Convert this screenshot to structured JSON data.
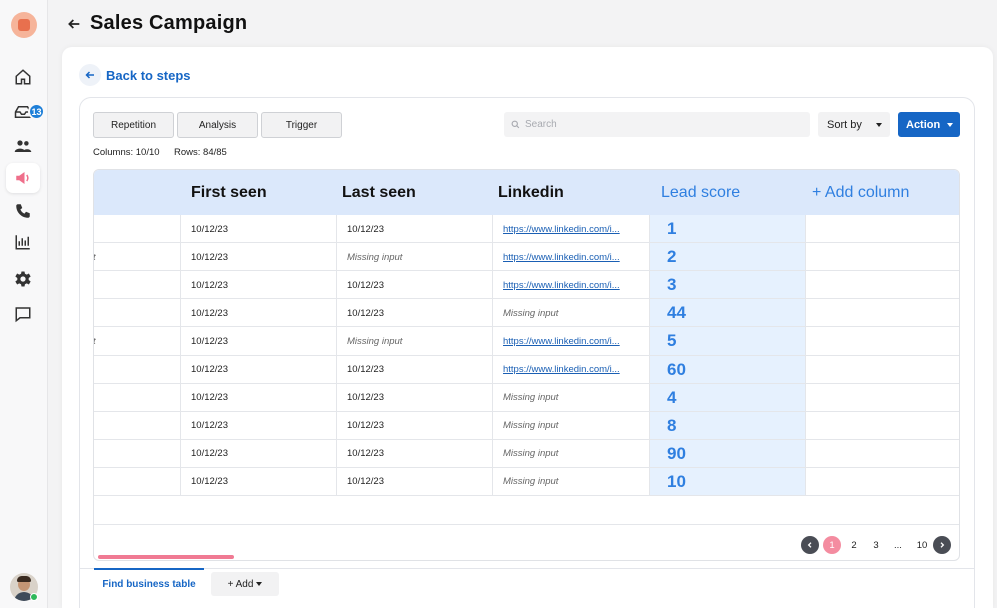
{
  "header": {
    "title": "Sales Campaign"
  },
  "nav": {
    "back_to_steps": "Back to steps",
    "notification_badge": "13"
  },
  "sidebar": {
    "items": [
      {
        "icon": "home-icon"
      },
      {
        "icon": "inbox-icon"
      },
      {
        "icon": "users-icon"
      },
      {
        "icon": "megaphone-icon",
        "active": true
      },
      {
        "icon": "phone-icon"
      },
      {
        "icon": "bar-chart-icon"
      },
      {
        "icon": "gear-icon"
      },
      {
        "icon": "chat-icon"
      }
    ]
  },
  "toolbar": {
    "tabs": [
      "Repetition",
      "Analysis",
      "Trigger"
    ],
    "search_placeholder": "Search",
    "sort_label": "Sort by",
    "action_label": "Action",
    "columns_info": "Columns: 10/10",
    "rows_info": "Rows: 84/85"
  },
  "table": {
    "columns": [
      "First seen",
      "Last seen",
      "Linkedin",
      "Lead score",
      "+ Add column"
    ],
    "rows": [
      {
        "clipped": "",
        "first_seen": "10/12/23",
        "last_seen": "10/12/23",
        "linkedin": "https://www.linkedin.com/i...",
        "score": "1"
      },
      {
        "clipped": "t",
        "first_seen": "10/12/23",
        "last_seen": "Missing input",
        "linkedin": "https://www.linkedin.com/i...",
        "score": "2"
      },
      {
        "clipped": "",
        "first_seen": "10/12/23",
        "last_seen": "10/12/23",
        "linkedin": "https://www.linkedin.com/i...",
        "score": "3"
      },
      {
        "clipped": "",
        "first_seen": "10/12/23",
        "last_seen": "10/12/23",
        "linkedin": "Missing input",
        "score": "44"
      },
      {
        "clipped": "t",
        "first_seen": "10/12/23",
        "last_seen": "Missing input",
        "linkedin": "https://www.linkedin.com/i...",
        "score": "5"
      },
      {
        "clipped": "",
        "first_seen": "10/12/23",
        "last_seen": "10/12/23",
        "linkedin": "https://www.linkedin.com/i...",
        "score": "60"
      },
      {
        "clipped": "",
        "first_seen": "10/12/23",
        "last_seen": "10/12/23",
        "linkedin": "Missing input",
        "score": "4"
      },
      {
        "clipped": "",
        "first_seen": "10/12/23",
        "last_seen": "10/12/23",
        "linkedin": "Missing input",
        "score": "8"
      },
      {
        "clipped": "",
        "first_seen": "10/12/23",
        "last_seen": "10/12/23",
        "linkedin": "Missing input",
        "score": "90"
      },
      {
        "clipped": "",
        "first_seen": "10/12/23",
        "last_seen": "10/12/23",
        "linkedin": "Missing input",
        "score": "10"
      }
    ],
    "missing_text": "Missing input"
  },
  "pagination": {
    "pages": [
      "1",
      "2",
      "3",
      "...",
      "10"
    ],
    "current": "1"
  },
  "bottom_tabs": {
    "active": "Find business table",
    "add_label": "+ Add"
  },
  "colors": {
    "accent": "#1666c5",
    "lead_score": "#2f7fe0",
    "header_bg": "#dbe8fb",
    "page_active": "#f48ca0",
    "badge": "#1e7fd8"
  }
}
